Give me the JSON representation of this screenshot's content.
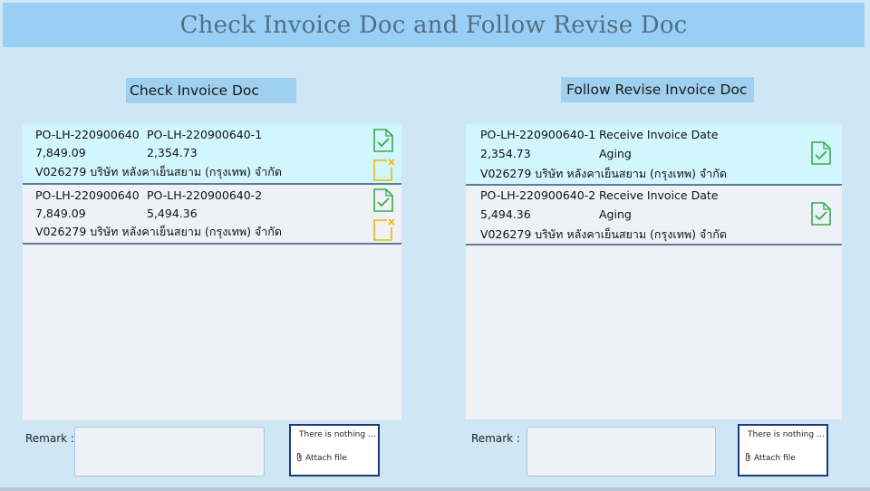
{
  "header": {
    "title": "Check Invoice Doc and Follow Revise Doc"
  },
  "left": {
    "section_title": "Check Invoice Doc",
    "rows": [
      {
        "po": "PO-LH-220900640",
        "po_sub": "PO-LH-220900640-1",
        "total": "7,849.09",
        "amount": "2,354.73",
        "vendor": "V026279 บริษัท หลังคาเย็นสยาม (กรุงเทพ) จำกัด"
      },
      {
        "po": "PO-LH-220900640",
        "po_sub": "PO-LH-220900640-2",
        "total": "7,849.09",
        "amount": "5,494.36",
        "vendor": "V026279 บริษัท หลังคาเย็นสยาม (กรุงเทพ) จำกัด"
      }
    ],
    "remark_label": "Remark :",
    "attach_empty": "There is nothing a...",
    "attach_label": "Attach file"
  },
  "right": {
    "section_title": "Follow Revise Invoice Doc",
    "rows": [
      {
        "po_sub": "PO-LH-220900640-1",
        "date_label": "Receive Invoice Date",
        "amount": "2,354.73",
        "aging_label": "Aging",
        "vendor": "V026279 บริษัท หลังคาเย็นสยาม (กรุงเทพ) จำกัด"
      },
      {
        "po_sub": "PO-LH-220900640-2",
        "date_label": "Receive Invoice Date",
        "amount": "5,494.36",
        "aging_label": "Aging",
        "vendor": "V026279 บริษัท หลังคาเย็นสยาม (กรุงเทพ) จำกัด"
      }
    ],
    "remark_label": "Remark :",
    "attach_empty": "There is nothing a...",
    "attach_label": "Attach file"
  },
  "icons": {
    "approve": "document-check-icon",
    "reject": "document-reject-icon",
    "attach": "paperclip-icon"
  },
  "colors": {
    "header_bg": "#99cff5",
    "page_bg": "#cfe7f5",
    "selected_row": "#d1f6fd",
    "approve_icon": "#3caa4f",
    "reject_icon": "#f2b705",
    "attach_border": "#1e3a7a"
  }
}
